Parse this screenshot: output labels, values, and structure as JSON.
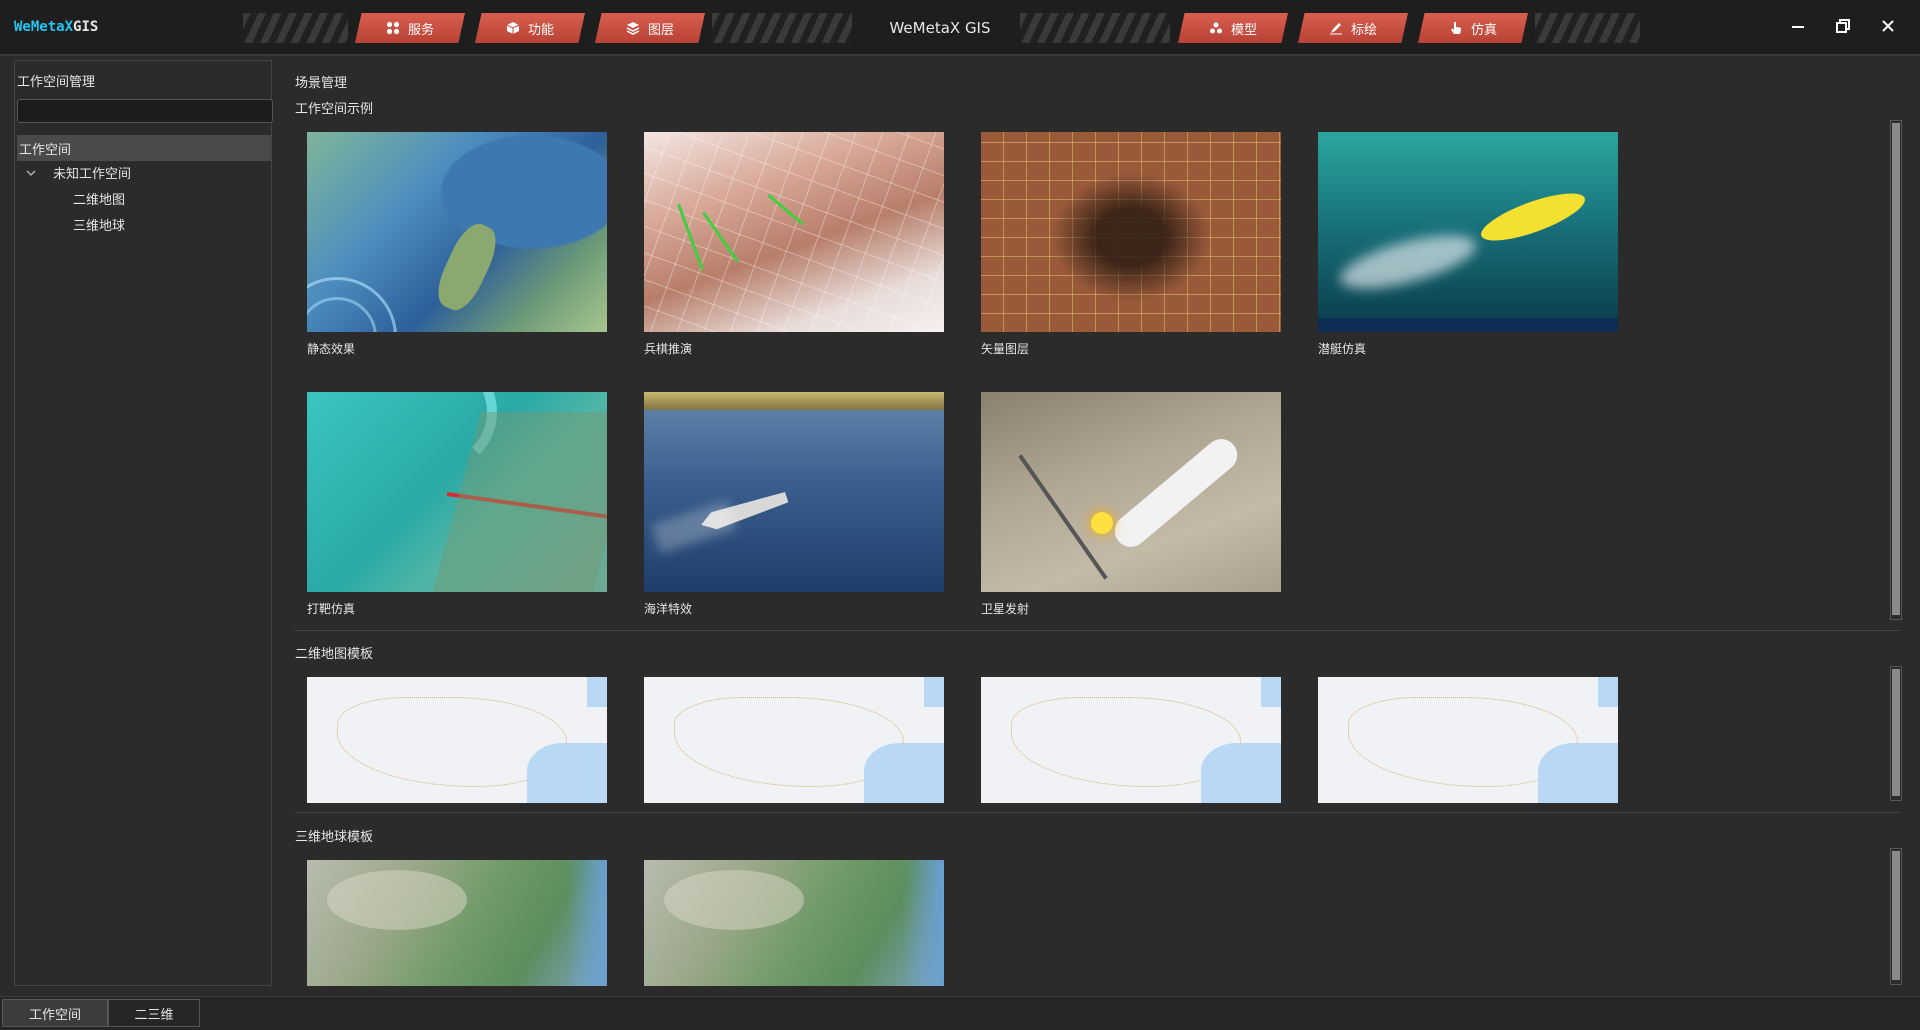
{
  "app": {
    "logo_we": "WeMetaX",
    "logo_gis": "GIS",
    "title": "WeMetaX GIS"
  },
  "nav_left": [
    {
      "label": "服务",
      "icon": "apps-grid-icon"
    },
    {
      "label": "功能",
      "icon": "cube-icon"
    },
    {
      "label": "图层",
      "icon": "layers-icon"
    }
  ],
  "nav_right": [
    {
      "label": "模型",
      "icon": "molecule-icon"
    },
    {
      "label": "标绘",
      "icon": "pen-draw-icon"
    },
    {
      "label": "仿真",
      "icon": "hand-pointer-icon"
    }
  ],
  "window_controls": [
    "minimize-icon",
    "restore-icon",
    "close-icon"
  ],
  "sidebar": {
    "title": "工作空间管理",
    "search_value": "",
    "tree": {
      "root": "工作空间",
      "node": "未知工作空间",
      "children": [
        "二维地图",
        "三维地球"
      ]
    }
  },
  "main": {
    "header": "场景管理",
    "examples_title": "工作空间示例",
    "examples": [
      {
        "caption": "静态效果"
      },
      {
        "caption": "兵棋推演"
      },
      {
        "caption": "矢量图层"
      },
      {
        "caption": "潜艇仿真"
      },
      {
        "caption": "打靶仿真"
      },
      {
        "caption": "海洋特效"
      },
      {
        "caption": "卫星发射"
      }
    ],
    "map2d_title": "二维地图模板",
    "map3d_title": "三维地球模板"
  },
  "bottom_tabs": [
    {
      "label": "工作空间",
      "active": true
    },
    {
      "label": "二三维",
      "active": false
    }
  ],
  "colors": {
    "accent": "#d9604f",
    "logo_blue": "#22c6f0",
    "background": "#2b2b2b",
    "titlebar": "#1e1e1e"
  }
}
